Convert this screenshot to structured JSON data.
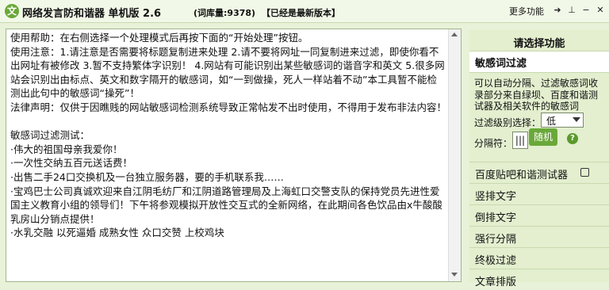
{
  "titlebar": {
    "icon_glyph": "文",
    "title": "网络发言防和谐器 单机版 2.6",
    "word_count": "(词库量:9378)",
    "version_note": "【已经是最新版本】",
    "more_functions": "更多功能",
    "buttons": {
      "pin": "➜",
      "pin_icon": "pin-icon",
      "bottom": "⊥",
      "bottom_icon": "dock-bottom-icon",
      "minimize": "−",
      "minimize_icon": "minimize-icon",
      "close": "✕",
      "close_icon": "close-icon"
    }
  },
  "editor": {
    "text": "使用帮助：在右侧选择一个处理模式后再按下面的“开始处理”按钮。\n使用注意：1.请注意是否需要将标题复制进来处理 2.请不要将网址一同复制进来过滤，即使你看不出网址有被修改 3.暂不支持繁体字识别！ 4.网站有可能识别出某些敏感词的谐音字和英文 5.很多网站会识别出由标点、英文和数字隔开的敏感词，如“一到做操，死人一样站着不动”本工具暂不能检测出此句中的敏感词“操死”！\n法律声明：仅供于因瞧贱的网站敏感词检测系统导致正常帖发不出时使用，不得用于发布非法内容！\n\n敏感词过滤测试：\n·伟大的祖国母亲我爱你！\n·一次性交纳五百元送话费！\n·出售二手24口交换机及一台独立服务器，要的手机联系我……\n·宝鸡巴士公司真诚欢迎来自江阴毛纺厂和江阴道路管理局及上海虹口交警支队的保持党员先进性爱国主义教育小组的领导们！下午将参观模拟开放性交互式的全新网络，在此期间各色饮品由x牛酸酸乳房山分销点提供！\n·水乳交融 以死逼婚 成熟女性 众口交赞 上校鸡块"
  },
  "right_panel": {
    "heading": "请选择功能",
    "active_item": "敏感词过滤",
    "filter": {
      "description": "可以自动分隔、过滤敏感词收录部分来自绿坝、百度和谐测试器及相关软件的敏感词",
      "level_label": "过滤级别选择：",
      "level_value": "低",
      "separator_label": "分隔符：",
      "separator_value": "|||",
      "random_button": "随机",
      "help_glyph": "?"
    },
    "menu_items": [
      "百度贴吧和谐测试器",
      "竖排文字",
      "倒排文字",
      "强行分隔",
      "终极过滤",
      "文章排版"
    ]
  },
  "colors": {
    "accent": "#6aa83a",
    "panel_bg": "#e3efcf"
  }
}
